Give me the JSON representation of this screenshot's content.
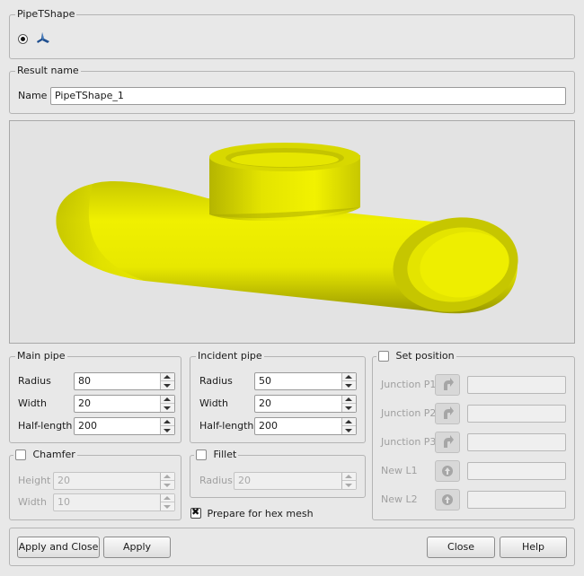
{
  "type_group": {
    "title": "PipeTShape",
    "icon": "pipe-tshape-icon"
  },
  "result": {
    "title": "Result name",
    "name_label": "Name",
    "name_value": "PipeTShape_1"
  },
  "viewer": {
    "shape_color": "#f0f000",
    "background": "#e3e3e3"
  },
  "main_pipe": {
    "title": "Main pipe",
    "rows": [
      {
        "label": "Radius",
        "value": "80"
      },
      {
        "label": "Width",
        "value": "20"
      },
      {
        "label": "Half-length",
        "value": "200"
      }
    ]
  },
  "incident_pipe": {
    "title": "Incident pipe",
    "rows": [
      {
        "label": "Radius",
        "value": "50"
      },
      {
        "label": "Width",
        "value": "20"
      },
      {
        "label": "Half-length",
        "value": "200"
      }
    ]
  },
  "chamfer": {
    "title": "Chamfer",
    "checked": false,
    "rows": [
      {
        "label": "Height",
        "value": "20"
      },
      {
        "label": "Width",
        "value": "10"
      }
    ]
  },
  "fillet": {
    "title": "Fillet",
    "checked": false,
    "rows": [
      {
        "label": "Radius",
        "value": "20"
      }
    ]
  },
  "hex_mesh": {
    "label": "Prepare for hex mesh",
    "checked": true
  },
  "set_position": {
    "title": "Set position",
    "checked": false,
    "rows": [
      {
        "label": "Junction P1",
        "icon": "select-arrow-icon"
      },
      {
        "label": "Junction P2",
        "icon": "select-arrow-icon"
      },
      {
        "label": "Junction P3",
        "icon": "select-arrow-icon"
      },
      {
        "label": "New L1",
        "icon": "select-point-icon"
      },
      {
        "label": "New L2",
        "icon": "select-point-icon"
      }
    ]
  },
  "buttons": {
    "apply_close": "Apply and Close",
    "apply": "Apply",
    "close": "Close",
    "help": "Help"
  }
}
